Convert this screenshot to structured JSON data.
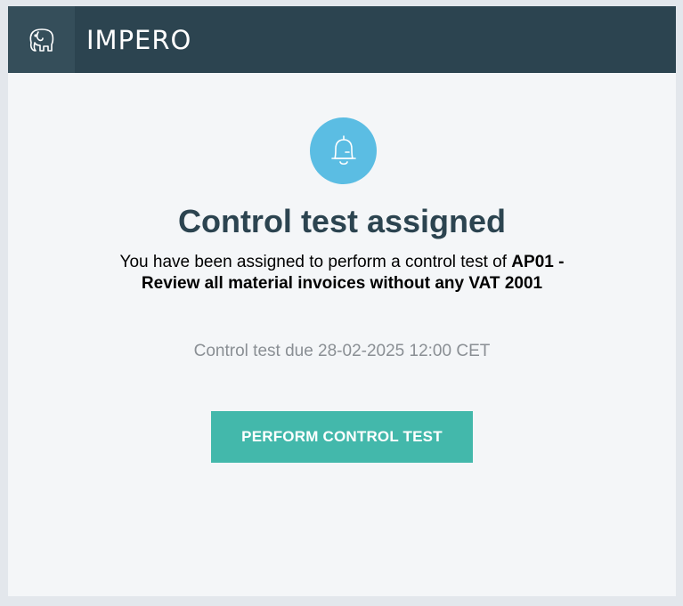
{
  "header": {
    "brand": "IMPERO",
    "logo_icon": "elephant-icon"
  },
  "notice": {
    "icon": "bell-icon",
    "title": "Control test assigned",
    "message_prefix": "You have been assigned to perform a control test of ",
    "control_name": "AP01 - Review all material invoices without any VAT 2001",
    "due_text": "Control test due 28-02-2025 12:00 CET"
  },
  "actions": {
    "perform_label": "PERFORM CONTROL TEST"
  },
  "colors": {
    "header_bg": "#2c4450",
    "logo_bg": "#354e5a",
    "bell_bg": "#5bbde3",
    "title_color": "#2c4450",
    "button_bg": "#43b8ab",
    "due_text_color": "#8a8f94"
  }
}
